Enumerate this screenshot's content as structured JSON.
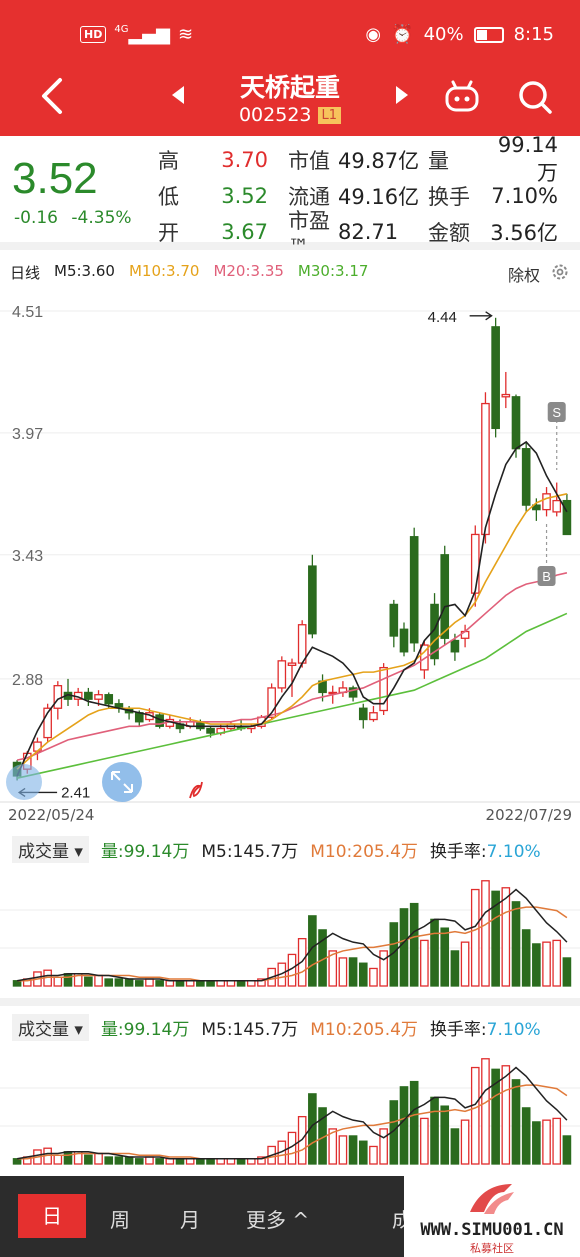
{
  "status": {
    "hd": "HD",
    "net": "4G",
    "battery": "40%",
    "time": "8:15"
  },
  "header": {
    "name": "天桥起重",
    "code": "002523",
    "level": "L1"
  },
  "quote": {
    "price": "3.52",
    "change": "-0.16",
    "change_pct": "-4.35%",
    "rows": [
      {
        "k1": "高",
        "v1": "3.70",
        "k2": "市值",
        "v2": "49.87亿",
        "k3": "量",
        "v3": "99.14万"
      },
      {
        "k1": "低",
        "v1": "3.52",
        "k2": "流通",
        "v2": "49.16亿",
        "k3": "换手",
        "v3": "7.10%"
      },
      {
        "k1": "开",
        "v1": "3.67",
        "k2": "市盈™",
        "v2": "82.71",
        "k3": "金额",
        "v3": "3.56亿"
      }
    ]
  },
  "ma_legend": {
    "period": "日线",
    "m5": "M5:3.60",
    "m10": "M10:3.70",
    "m20": "M20:3.35",
    "m30": "M30:3.17",
    "adjust": "除权"
  },
  "colors": {
    "up": "#e02d2d",
    "down": "#2b6b1e",
    "m5": "#222222",
    "m10": "#e5a21a",
    "m20": "#e0607a",
    "m30": "#5cbf3c",
    "vol_ma5": "#222222",
    "vol_ma10": "#e07a3a",
    "turnover": "#2aa5d6"
  },
  "chart_data": {
    "type": "candlestick",
    "y_ticks": [
      "4.51",
      "3.97",
      "3.43",
      "2.88"
    ],
    "ylim": [
      2.37,
      4.55
    ],
    "high_label": "4.44",
    "low_label": "2.41",
    "marker_s": "S",
    "marker_b": "B",
    "start_date": "2022/05/24",
    "end_date": "2022/07/29",
    "candles": [
      [
        2.51,
        2.45,
        2.52,
        2.43
      ],
      [
        2.48,
        2.55,
        2.56,
        2.46
      ],
      [
        2.56,
        2.6,
        2.62,
        2.52
      ],
      [
        2.62,
        2.75,
        2.77,
        2.6
      ],
      [
        2.75,
        2.85,
        2.87,
        2.7
      ],
      [
        2.82,
        2.79,
        2.88,
        2.76
      ],
      [
        2.79,
        2.82,
        2.84,
        2.76
      ],
      [
        2.82,
        2.79,
        2.84,
        2.76
      ],
      [
        2.79,
        2.81,
        2.83,
        2.76
      ],
      [
        2.81,
        2.77,
        2.82,
        2.75
      ],
      [
        2.77,
        2.75,
        2.79,
        2.73
      ],
      [
        2.75,
        2.73,
        2.76,
        2.7
      ],
      [
        2.73,
        2.69,
        2.74,
        2.67
      ],
      [
        2.7,
        2.73,
        2.75,
        2.69
      ],
      [
        2.72,
        2.67,
        2.73,
        2.66
      ],
      [
        2.67,
        2.7,
        2.72,
        2.66
      ],
      [
        2.68,
        2.66,
        2.7,
        2.64
      ],
      [
        2.67,
        2.69,
        2.71,
        2.66
      ],
      [
        2.69,
        2.66,
        2.7,
        2.65
      ],
      [
        2.66,
        2.64,
        2.67,
        2.62
      ],
      [
        2.64,
        2.66,
        2.68,
        2.63
      ],
      [
        2.66,
        2.68,
        2.69,
        2.65
      ],
      [
        2.67,
        2.66,
        2.7,
        2.65
      ],
      [
        2.66,
        2.67,
        2.68,
        2.64
      ],
      [
        2.67,
        2.71,
        2.72,
        2.66
      ],
      [
        2.71,
        2.84,
        2.86,
        2.7
      ],
      [
        2.84,
        2.96,
        2.98,
        2.82
      ],
      [
        2.94,
        2.95,
        2.97,
        2.8
      ],
      [
        2.95,
        3.12,
        3.14,
        2.93
      ],
      [
        3.38,
        3.08,
        3.43,
        3.06
      ],
      [
        2.87,
        2.82,
        2.9,
        2.78
      ],
      [
        2.82,
        2.82,
        2.85,
        2.77
      ],
      [
        2.82,
        2.84,
        2.87,
        2.8
      ],
      [
        2.84,
        2.8,
        2.85,
        2.78
      ],
      [
        2.75,
        2.7,
        2.77,
        2.66
      ],
      [
        2.7,
        2.73,
        2.76,
        2.69
      ],
      [
        2.74,
        2.93,
        2.95,
        2.72
      ],
      [
        3.21,
        3.07,
        3.23,
        3.02
      ],
      [
        3.1,
        3.0,
        3.13,
        2.98
      ],
      [
        3.51,
        3.04,
        3.55,
        3.0
      ],
      [
        2.92,
        3.03,
        3.05,
        2.88
      ],
      [
        3.21,
        2.97,
        3.26,
        2.94
      ],
      [
        3.43,
        3.06,
        3.47,
        3.03
      ],
      [
        3.05,
        3.0,
        3.08,
        2.96
      ],
      [
        3.06,
        3.09,
        3.12,
        3.02
      ],
      [
        3.26,
        3.52,
        3.56,
        3.2
      ],
      [
        3.52,
        4.1,
        4.15,
        3.48
      ],
      [
        4.44,
        3.99,
        4.48,
        3.95
      ],
      [
        4.13,
        4.14,
        4.24,
        4.08
      ],
      [
        4.13,
        3.9,
        4.14,
        3.86
      ],
      [
        3.9,
        3.65,
        3.93,
        3.62
      ],
      [
        3.65,
        3.63,
        3.68,
        3.58
      ],
      [
        3.63,
        3.7,
        3.73,
        3.6
      ],
      [
        3.62,
        3.67,
        3.75,
        3.6
      ],
      [
        3.67,
        3.52,
        3.7,
        3.52
      ]
    ],
    "ma5": [
      2.45,
      2.55,
      2.65,
      2.73,
      2.79,
      2.81,
      2.8,
      2.78,
      2.77,
      2.76,
      2.75,
      2.74,
      2.73,
      2.72,
      2.7,
      2.69,
      2.68,
      2.67,
      2.67,
      2.67,
      2.67,
      2.67,
      2.67,
      2.67,
      2.68,
      2.73,
      2.8,
      2.86,
      2.95,
      3.02,
      3.0,
      2.98,
      2.95,
      2.9,
      2.8,
      2.77,
      2.77,
      2.84,
      2.92,
      2.95,
      3.05,
      3.1,
      3.2,
      3.21,
      3.16,
      3.27,
      3.55,
      3.7,
      3.83,
      3.9,
      3.93,
      3.88,
      3.78,
      3.7,
      3.62
    ],
    "ma10": [
      2.48,
      2.52,
      2.56,
      2.6,
      2.63,
      2.66,
      2.69,
      2.72,
      2.74,
      2.75,
      2.75,
      2.75,
      2.75,
      2.74,
      2.73,
      2.72,
      2.71,
      2.7,
      2.69,
      2.68,
      2.68,
      2.68,
      2.68,
      2.68,
      2.68,
      2.7,
      2.73,
      2.76,
      2.8,
      2.85,
      2.87,
      2.88,
      2.89,
      2.9,
      2.91,
      2.91,
      2.92,
      2.93,
      2.94,
      2.96,
      3.0,
      3.05,
      3.09,
      3.13,
      3.16,
      3.22,
      3.31,
      3.39,
      3.47,
      3.55,
      3.62,
      3.66,
      3.68,
      3.69,
      3.7
    ],
    "ma20": [
      2.52,
      2.53,
      2.55,
      2.57,
      2.59,
      2.61,
      2.62,
      2.63,
      2.64,
      2.65,
      2.66,
      2.67,
      2.67,
      2.68,
      2.68,
      2.69,
      2.69,
      2.69,
      2.69,
      2.69,
      2.69,
      2.69,
      2.7,
      2.7,
      2.71,
      2.72,
      2.73,
      2.75,
      2.77,
      2.79,
      2.8,
      2.81,
      2.82,
      2.83,
      2.84,
      2.86,
      2.88,
      2.9,
      2.92,
      2.94,
      2.97,
      3.0,
      3.03,
      3.06,
      3.09,
      3.13,
      3.17,
      3.21,
      3.25,
      3.28,
      3.3,
      3.31,
      3.32,
      3.34,
      3.35
    ],
    "ma30": [
      2.44,
      2.45,
      2.46,
      2.47,
      2.48,
      2.49,
      2.5,
      2.51,
      2.52,
      2.53,
      2.54,
      2.55,
      2.56,
      2.57,
      2.58,
      2.59,
      2.6,
      2.61,
      2.62,
      2.63,
      2.64,
      2.65,
      2.66,
      2.67,
      2.68,
      2.69,
      2.7,
      2.71,
      2.72,
      2.73,
      2.74,
      2.75,
      2.76,
      2.77,
      2.78,
      2.79,
      2.8,
      2.81,
      2.82,
      2.83,
      2.85,
      2.87,
      2.89,
      2.91,
      2.93,
      2.95,
      2.97,
      3.0,
      3.03,
      3.06,
      3.09,
      3.11,
      3.13,
      3.15,
      3.17
    ],
    "volume": [
      3,
      4,
      8,
      9,
      5,
      7,
      7,
      5,
      6,
      4,
      4,
      4,
      3,
      4,
      3,
      3,
      3,
      3,
      3,
      3,
      3,
      3,
      3,
      3,
      4,
      10,
      13,
      18,
      27,
      40,
      32,
      20,
      16,
      16,
      13,
      10,
      20,
      36,
      44,
      47,
      26,
      38,
      33,
      20,
      25,
      55,
      60,
      54,
      56,
      48,
      32,
      24,
      25,
      26,
      16
    ],
    "vol_ma5": [
      3,
      4,
      5,
      6,
      6,
      7,
      7,
      7,
      6,
      6,
      5,
      4,
      4,
      4,
      4,
      3,
      3,
      3,
      3,
      3,
      3,
      3,
      3,
      3,
      3,
      5,
      7,
      10,
      14,
      22,
      26,
      30,
      27,
      25,
      24,
      18,
      15,
      19,
      25,
      31,
      34,
      38,
      38,
      37,
      32,
      34,
      42,
      46,
      50,
      55,
      50,
      43,
      36,
      31,
      25
    ],
    "vol_ma10": [
      3,
      3,
      4,
      5,
      5,
      5,
      6,
      6,
      6,
      6,
      6,
      6,
      5,
      5,
      5,
      4,
      4,
      4,
      3,
      3,
      3,
      3,
      3,
      3,
      3,
      4,
      5,
      6,
      8,
      12,
      15,
      18,
      20,
      21,
      22,
      22,
      23,
      24,
      26,
      28,
      29,
      30,
      30,
      31,
      30,
      32,
      35,
      39,
      42,
      44,
      45,
      45,
      44,
      43,
      39
    ]
  },
  "volume_panel": {
    "title": "成交量",
    "vol": "量:99.14万",
    "ma5": "M5:145.7万",
    "ma10": "M10:205.4万",
    "turnover_label": "换手率:",
    "turnover": "7.10%"
  },
  "bottom": {
    "day": "日",
    "week": "周",
    "month": "月",
    "more": "更多 ^",
    "partial": "成"
  },
  "watermark": {
    "text": "WWW.SIMU001.CN",
    "sub": "私募社区"
  }
}
